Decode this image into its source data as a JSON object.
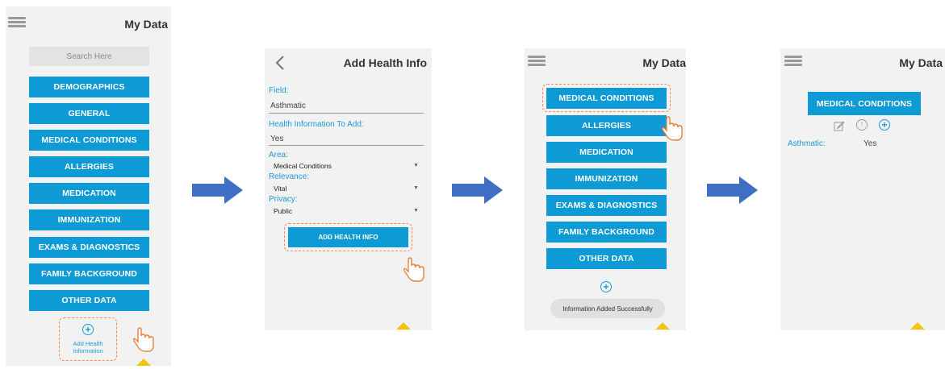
{
  "screen1": {
    "title": "My Data",
    "search_placeholder": "Search Here",
    "menu": [
      "DEMOGRAPHICS",
      "GENERAL",
      "MEDICAL CONDITIONS",
      "ALLERGIES",
      "MEDICATION",
      "IMMUNIZATION",
      "EXAMS & DIAGNOSTICS",
      "FAMILY BACKGROUND",
      "OTHER DATA"
    ],
    "add_label": "Add Health Information"
  },
  "screen2": {
    "title": "Add Health Info",
    "field_label": "Field:",
    "field_value": "Asthmatic",
    "info_label": "Health Information To Add:",
    "info_value": "Yes",
    "area_label": "Area:",
    "area_value": "Medical Conditions",
    "relevance_label": "Relevance:",
    "relevance_value": "Vital",
    "privacy_label": "Privacy:",
    "privacy_value": "Public",
    "submit": "ADD HEALTH INFO"
  },
  "screen3": {
    "title": "My Data",
    "menu": [
      "MEDICAL CONDITIONS",
      "ALLERGIES",
      "MEDICATION",
      "IMMUNIZATION",
      "EXAMS & DIAGNOSTICS",
      "FAMILY BACKGROUND",
      "OTHER DATA"
    ],
    "toast": "Information Added Successfully"
  },
  "screen4": {
    "title": "My Data",
    "header_button": "MEDICAL CONDITIONS",
    "row_label": "Asthmatic:",
    "row_value": "Yes"
  },
  "colors": {
    "accent": "#0e9ad4",
    "label": "#1a9ad6",
    "highlight": "#f28c5a",
    "arrow": "#3f6fc4",
    "triangle": "#f1c40f"
  }
}
